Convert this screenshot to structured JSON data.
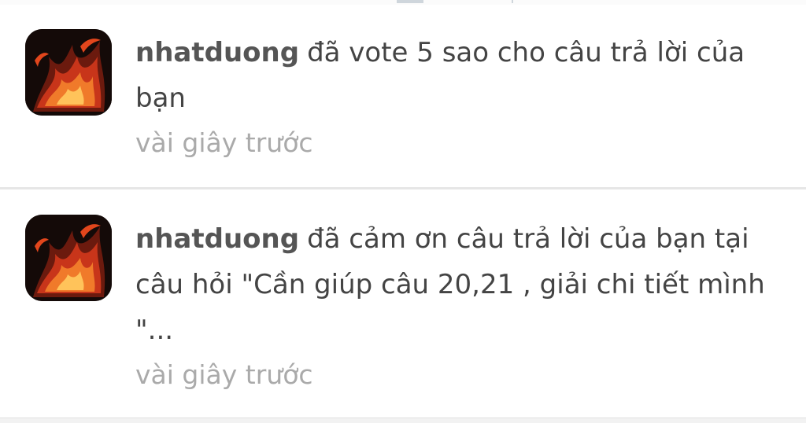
{
  "notifications": [
    {
      "username": "nhatduong",
      "message": "đã vote 5 sao cho câu trả lời của bạn",
      "time": "vài giây trước",
      "avatar_icon": "fire-avatar"
    },
    {
      "username": "nhatduong",
      "message": "đã cảm ơn câu trả lời của bạn tại câu hỏi \"Cần giúp câu 20,21 , giải chi tiết mình  \"...",
      "time": "vài giây trước",
      "avatar_icon": "fire-avatar"
    }
  ],
  "colors": {
    "text": "#444444",
    "username": "#555555",
    "timestamp": "#aaaaaa",
    "divider": "#e6e6e6",
    "avatar_bg": "#140a08",
    "flame": "#e2461c"
  }
}
